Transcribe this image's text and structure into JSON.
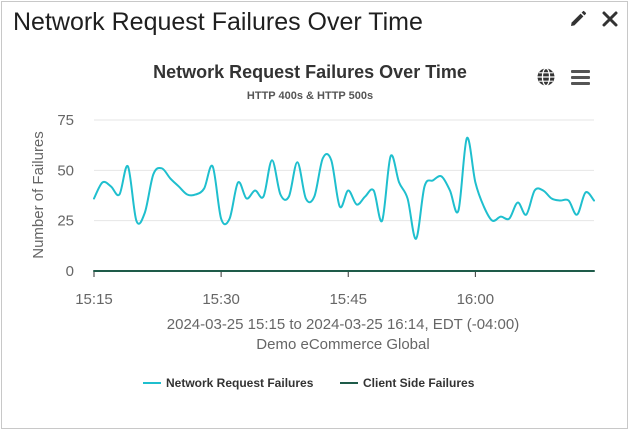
{
  "panel": {
    "title": "Network Request Failures Over Time",
    "edit_icon": "pencil-icon",
    "close_icon": "close-icon"
  },
  "chart_toolbar": {
    "globe_icon": "globe-icon",
    "menu_icon": "hamburger-menu-icon"
  },
  "colors": {
    "network_request_failures": "#1fbfce",
    "client_side_failures": "#1e5b49",
    "grid": "#e6e6e6",
    "text": "#333333",
    "axis_text": "#666666"
  },
  "chart_data": {
    "type": "line",
    "title": "Network Request Failures Over Time",
    "subtitle": "HTTP 400s & HTTP 500s",
    "ylabel": "Number of Failures",
    "xlabel": "2024-03-25 15:15 to 2024-03-25 16:14, EDT (-04:00)",
    "xlabel_sub": "Demo eCommerce Global",
    "x_start": "2024-03-25 15:15",
    "x_end": "2024-03-25 16:14",
    "xlim": [
      "15:15",
      "16:14"
    ],
    "ylim": [
      0,
      75
    ],
    "x_ticks": [
      "15:15",
      "15:30",
      "15:45",
      "16:00"
    ],
    "y_ticks": [
      0,
      25,
      50,
      75
    ],
    "grid": true,
    "legend_position": "bottom",
    "series": [
      {
        "name": "Network Request Failures",
        "color": "#1fbfce",
        "x": [
          "15:15",
          "15:16",
          "15:17",
          "15:18",
          "15:19",
          "15:20",
          "15:21",
          "15:22",
          "15:23",
          "15:24",
          "15:25",
          "15:26",
          "15:27",
          "15:28",
          "15:29",
          "15:30",
          "15:31",
          "15:32",
          "15:33",
          "15:34",
          "15:35",
          "15:36",
          "15:37",
          "15:38",
          "15:39",
          "15:40",
          "15:41",
          "15:42",
          "15:43",
          "15:44",
          "15:45",
          "15:46",
          "15:47",
          "15:48",
          "15:49",
          "15:50",
          "15:51",
          "15:52",
          "15:53",
          "15:54",
          "15:55",
          "15:56",
          "15:57",
          "15:58",
          "15:59",
          "16:00",
          "16:01",
          "16:02",
          "16:03",
          "16:04",
          "16:05",
          "16:06",
          "16:07",
          "16:08",
          "16:09",
          "16:10",
          "16:11",
          "16:12",
          "16:13",
          "16:14"
        ],
        "values": [
          36,
          44,
          42,
          38,
          52,
          25,
          29,
          48,
          51,
          46,
          42,
          38,
          38,
          41,
          52,
          26,
          26,
          44,
          36,
          40,
          37,
          55,
          38,
          37,
          54,
          36,
          37,
          56,
          55,
          32,
          40,
          33,
          37,
          40,
          25,
          57,
          44,
          36,
          16,
          42,
          45,
          47,
          40,
          30,
          66,
          44,
          32,
          25,
          27,
          26,
          34,
          28,
          40,
          40,
          36,
          35,
          35,
          28,
          39,
          35
        ]
      },
      {
        "name": "Client Side Failures",
        "color": "#1e5b49",
        "x": [
          "15:15",
          "16:14"
        ],
        "values": [
          0,
          0
        ]
      }
    ]
  }
}
